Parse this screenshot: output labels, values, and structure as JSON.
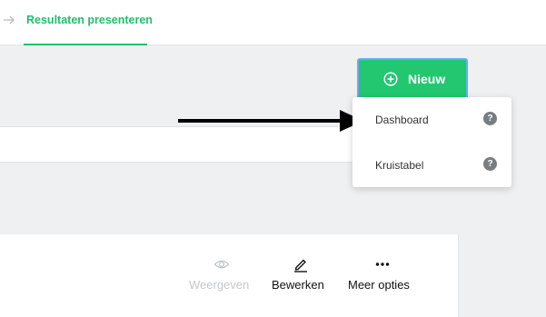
{
  "header": {
    "active_tab_label": "Resultaten presenteren"
  },
  "toolbar": {
    "new_button_label": "Nieuw"
  },
  "new_menu": {
    "items": [
      {
        "label": "Dashboard",
        "help": "?"
      },
      {
        "label": "Kruistabel",
        "help": "?"
      }
    ]
  },
  "card_actions": {
    "view_label": "Weergeven",
    "edit_label": "Bewerken",
    "more_label": "Meer opties"
  },
  "colors": {
    "accent_green": "#22c770",
    "tab_green": "#22c06a",
    "focus_ring": "#6aa8ff",
    "disabled_text": "#c3c7ca"
  },
  "icons": {
    "breadcrumb": "arrow-right-icon",
    "new": "plus-circle-icon",
    "help": "question-circle-icon",
    "view": "eye-icon",
    "edit": "pencil-icon",
    "more": "ellipsis-icon",
    "annotation": "black-arrow-icon"
  }
}
